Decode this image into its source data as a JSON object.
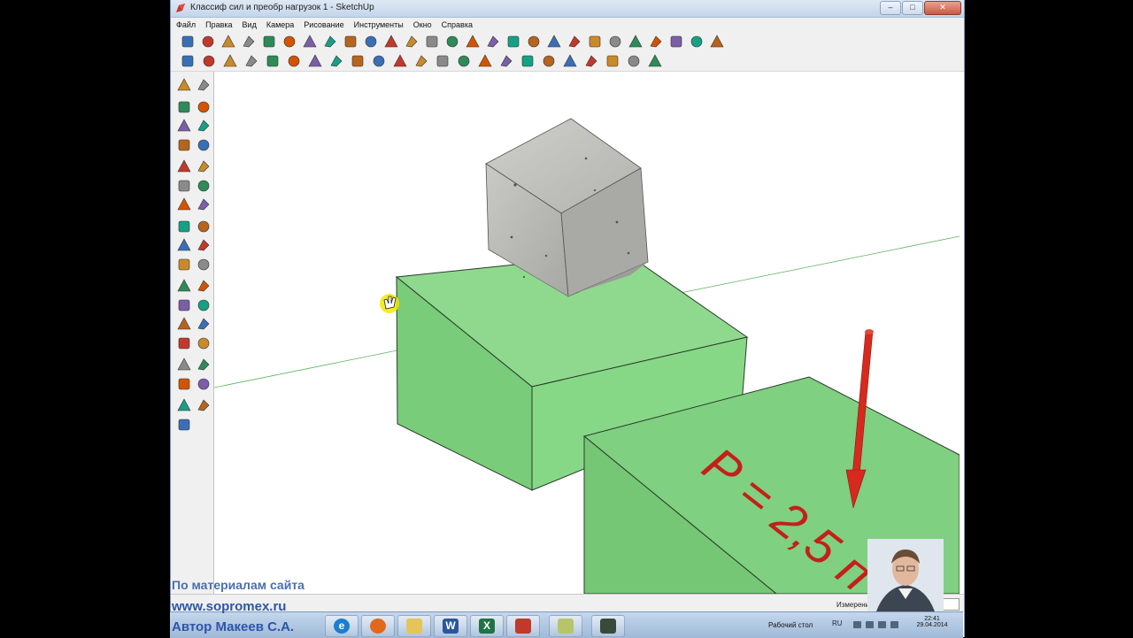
{
  "window": {
    "title": "Классиф сил и преобр нагрузок 1 - SketchUp",
    "buttons": {
      "minimize": "–",
      "maximize": "□",
      "close": "✕"
    }
  },
  "menu": [
    "Файл",
    "Правка",
    "Вид",
    "Камера",
    "Рисование",
    "Инструменты",
    "Окно",
    "Справка"
  ],
  "toolbar": {
    "row1_icons": [
      "select-icon",
      "pencil-icon",
      "rectangle-icon",
      "circle-icon",
      "arc-icon",
      "eraser-icon",
      "eraser2-icon",
      "tape-icon",
      "paint-bucket-icon",
      "move-icon",
      "rotate-icon",
      "scale-icon",
      "offset-icon",
      "push-pull-icon",
      "follow-me-icon",
      "orbit-icon",
      "pan-icon",
      "zoom-icon",
      "zoom-extents-icon",
      "section-icon",
      "walk-icon",
      "look-around-icon",
      "position-camera-icon",
      "earth-icon",
      "component-icon",
      "warehouse-icon",
      "shadows-icon"
    ],
    "row2_icons": [
      "new-icon",
      "open-icon",
      "save-icon",
      "cut-icon",
      "copy-icon",
      "paste-icon",
      "delete-icon",
      "undo-icon",
      "redo-icon",
      "print-icon",
      "model-info-icon",
      "iso-view-icon",
      "top-view-icon",
      "front-view-icon",
      "right-view-icon",
      "back-view-icon",
      "left-view-icon",
      "xray-icon",
      "wireframe-icon",
      "hidden-line-icon",
      "shaded-icon",
      "textured-icon",
      "monochrome-icon"
    ]
  },
  "scene": {
    "label_text": "P = 2,5 п",
    "arrow_color": "#d62a1e",
    "box_color": "#7dd07e",
    "cube_color": "#b6b6b2"
  },
  "status": {
    "measurements_label": "Измерения",
    "measurements_value": ""
  },
  "taskbar": {
    "desktop_label": "Рабочий стол",
    "lang": "RU",
    "time": "22:41",
    "date": "29.04.2014",
    "apps": [
      "ie-icon",
      "firefox-icon",
      "explorer-icon",
      "word-icon",
      "excel-icon",
      "sketchup-icon",
      "notes-icon",
      "recorder-icon"
    ]
  },
  "watermark": {
    "line1": "По материалам сайта",
    "line2": "www.sopromex.ru",
    "line3": "Автор Макеев С.А."
  }
}
